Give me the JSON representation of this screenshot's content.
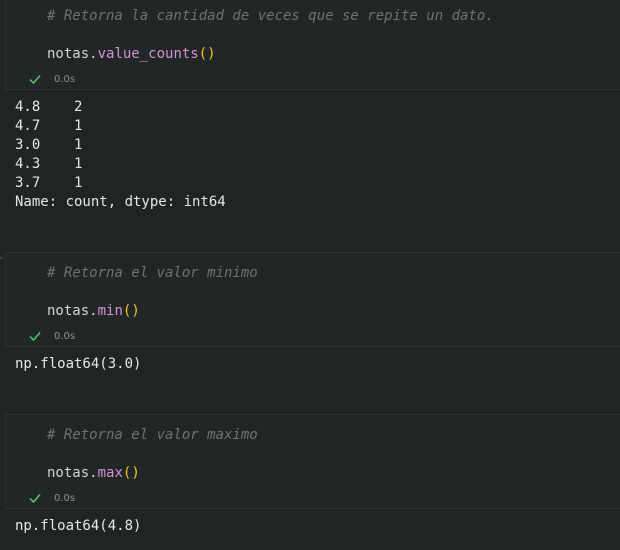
{
  "cells": [
    {
      "comment": "# Retorna la cantidad de veces que se repite un dato.",
      "code": {
        "var": "notas",
        "dot": ".",
        "method": "value_counts",
        "parens": "()"
      },
      "exec_time": "0.0s",
      "output": [
        "4.8    2",
        "4.7    1",
        "3.0    1",
        "4.3    1",
        "3.7    1",
        "Name: count, dtype: int64"
      ]
    },
    {
      "comment": "# Retorna el valor minimo",
      "code": {
        "var": "notas",
        "dot": ".",
        "method": "min",
        "parens": "()"
      },
      "exec_time": "0.0s",
      "output": [
        "np.float64(3.0)"
      ]
    },
    {
      "comment": "# Retorna el valor maximo",
      "code": {
        "var": "notas",
        "dot": ".",
        "method": "max",
        "parens": "()"
      },
      "exec_time": "0.0s",
      "output": [
        "np.float64(4.8)"
      ]
    }
  ],
  "icons": {
    "status": "check-icon"
  },
  "colors": {
    "background": "#1f2424",
    "cell": "#212727",
    "comment": "#6b7373",
    "method": "#d98fd9",
    "paren": "#f5c518",
    "check": "#4ec96b"
  }
}
